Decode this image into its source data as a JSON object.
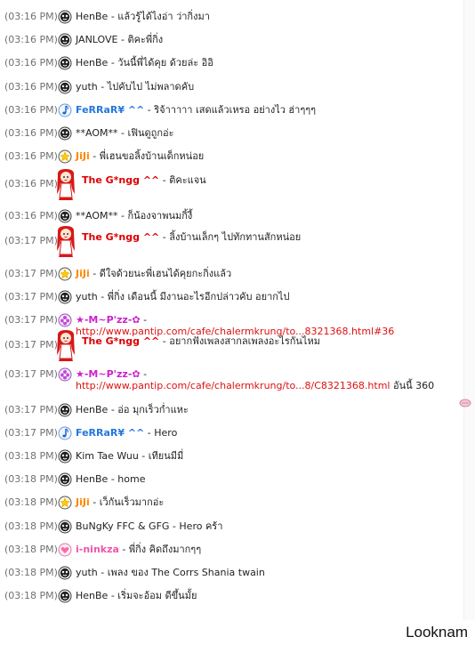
{
  "messages": [
    {
      "time": "(03:16 PM)",
      "icon": "ghost-icon",
      "nick": "HenBe",
      "nick_style": "plain",
      "text": " - แล้วรู้ได้ไงอ่า ว่ากิ่งมา"
    },
    {
      "time": "(03:16 PM)",
      "icon": "ghost-icon",
      "nick": "JANLOVE",
      "nick_style": "plain",
      "text": " - ติคะพี่กิ่ง"
    },
    {
      "time": "(03:16 PM)",
      "icon": "ghost-icon",
      "nick": "HenBe",
      "nick_style": "plain",
      "text": " - วันนี้พี่ได้คุย ด้วยล่ะ อิอิ"
    },
    {
      "time": "(03:16 PM)",
      "icon": "ghost-icon",
      "nick": "yuth",
      "nick_style": "plain",
      "text": " - ไปคับไป ไม่พลาดคับ"
    },
    {
      "time": "(03:16 PM)",
      "icon": "music-note-icon",
      "nick": "FeRRaR¥ ^^",
      "nick_style": "blue",
      "text": " - ริจ้าาาาา เสดแล้วเหรอ อย่างไว ฮ่าๆๆๆ"
    },
    {
      "time": "(03:16 PM)",
      "icon": "ghost-icon",
      "nick": "**AOM**",
      "nick_style": "plain",
      "text": " - เฟินดูถูกอ่ะ"
    },
    {
      "time": "(03:16 PM)",
      "icon": "star-icon",
      "nick": "JiJi",
      "nick_style": "orange",
      "text": " - พี่เฮนขอลิ้งบ้านเด็กหน่อย"
    },
    {
      "time": "(03:16 PM)",
      "icon": "red-hair-girl-avatar-icon",
      "nick": "The G*ngg ^^",
      "nick_style": "red",
      "text": " - ติคะแจน"
    },
    {
      "time": "(03:16 PM)",
      "icon": "ghost-icon",
      "nick": "**AOM**",
      "nick_style": "plain",
      "text": " - ก็น้องจาพนมกิ้งี้"
    },
    {
      "time": "(03:17 PM)",
      "icon": "red-hair-girl-avatar-icon",
      "nick": "The G*ngg ^^",
      "nick_style": "red",
      "text": " - ลิ้งบ้านเล็กๆ ไปทักทานสักหน่อย"
    },
    {
      "time": "(03:17 PM)",
      "icon": "star-icon",
      "nick": "JiJi",
      "nick_style": "orange",
      "text": " - ดีใจด้วยนะพี่เฮนได้คุยกะกิ่งแล้ว"
    },
    {
      "time": "(03:17 PM)",
      "icon": "ghost-icon",
      "nick": "yuth",
      "nick_style": "plain",
      "text": " - พี่กิ่ง เดือนนี้ มีงานอะไรอีกปล่าวคับ อยากไป"
    },
    {
      "time": "(03:17 PM)",
      "icon": "purple-flower-icon",
      "nick": "★-M~P'zz-✿",
      "nick_style": "purple",
      "text": " - ",
      "link": "http://www.pantip.com/cafe/chalermkrung/to...8321368.html#36"
    },
    {
      "time": "(03:17 PM)",
      "icon": "red-hair-girl-avatar-icon",
      "nick": "The G*ngg ^^",
      "nick_style": "red",
      "text": " - อยากฟังเพลงสากลเพลงอะไรกันไหม"
    },
    {
      "time": "(03:17 PM)",
      "icon": "purple-flower-icon",
      "nick": "★-M~P'zz-✿",
      "nick_style": "purple",
      "text": " - ",
      "link": "http://www.pantip.com/cafe/chalermkrung/to...8/C8321368.html",
      "after": " อันนี้ 360"
    },
    {
      "time": "(03:17 PM)",
      "icon": "ghost-icon",
      "nick": "HenBe",
      "nick_style": "plain",
      "text": " - อ่อ มุกเร็วก่ำแหะ"
    },
    {
      "time": "(03:17 PM)",
      "icon": "music-note-icon",
      "nick": "FeRRaR¥ ^^",
      "nick_style": "blue",
      "text": " - Hero"
    },
    {
      "time": "(03:18 PM)",
      "icon": "ghost-icon",
      "nick": "Kim Tae Wuu",
      "nick_style": "plain",
      "text": " - เทียนมีมี่"
    },
    {
      "time": "(03:18 PM)",
      "icon": "ghost-icon",
      "nick": "HenBe",
      "nick_style": "plain",
      "text": " - home"
    },
    {
      "time": "(03:18 PM)",
      "icon": "star-icon",
      "nick": "JiJi",
      "nick_style": "orange",
      "text": " - เว็กันเร็วมากอ่ะ"
    },
    {
      "time": "(03:18 PM)",
      "icon": "ghost-icon",
      "nick": "BuNgKy FFC & GFG",
      "nick_style": "plain",
      "text": " - Hero คร้า"
    },
    {
      "time": "(03:18 PM)",
      "icon": "pink-heart-icon",
      "nick": "i-ninkza",
      "nick_style": "pink",
      "text": " - พี่กิ่ง คิดถึงมากๆๆ"
    },
    {
      "time": "(03:18 PM)",
      "icon": "ghost-icon",
      "nick": "yuth",
      "nick_style": "plain",
      "text": " - เพลง ของ The Corrs Shania twain"
    },
    {
      "time": "(03:18 PM)",
      "icon": "ghost-icon",
      "nick": "HenBe",
      "nick_style": "plain",
      "text": " - เริ่มจะอ้อม ดีขึ้นมั้ย"
    }
  ],
  "watermark": "Looknam"
}
